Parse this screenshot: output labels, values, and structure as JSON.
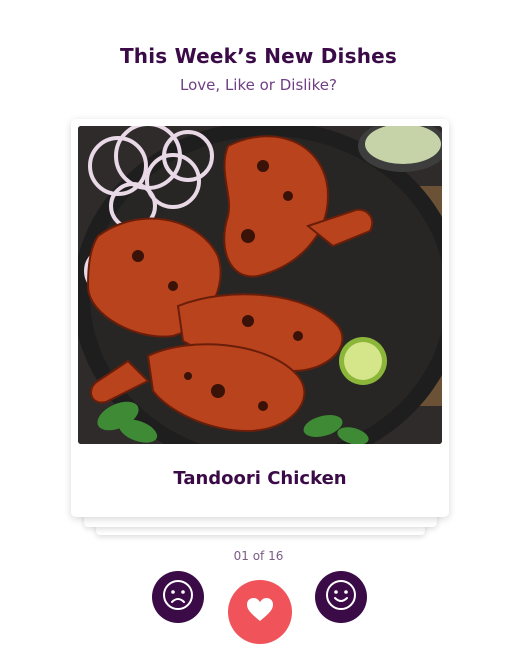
{
  "header": {
    "title": "This Week’s New Dishes",
    "subtitle": "Love, Like or Dislike?"
  },
  "card": {
    "dish_name": "Tandoori Chicken",
    "image_icon": "tandoori-chicken-photo"
  },
  "pager": {
    "counter": "01 of 16"
  },
  "actions": {
    "dislike_icon": "sad-face-icon",
    "love_icon": "heart-icon",
    "like_icon": "happy-face-icon"
  },
  "colors": {
    "brand_purple": "#3b0b48",
    "love_red": "#f0545a",
    "subtitle_purple": "#6f3f85"
  }
}
